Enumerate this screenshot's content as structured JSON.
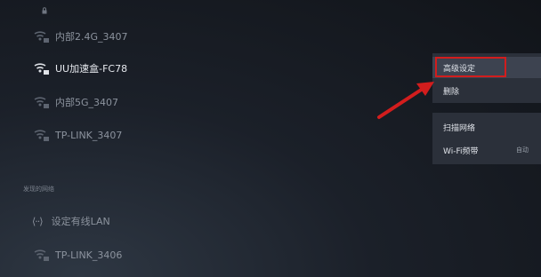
{
  "networks": [
    {
      "name": "内部2.4G_3407",
      "active": false
    },
    {
      "name": "UU加速盒-FC78",
      "active": true
    },
    {
      "name": "内部5G_3407",
      "active": false
    },
    {
      "name": "TP-LINK_3407",
      "active": false
    }
  ],
  "section": {
    "label": "发现的网络"
  },
  "wired": {
    "label": "设定有线LAN"
  },
  "network_bottom": {
    "name": "TP-LINK_3406"
  },
  "context_menu": {
    "advanced_label": "高级设定",
    "delete_label": "删除",
    "scan_label": "扫描网络",
    "band_label": "Wi-Fi频带",
    "band_value": "自动"
  },
  "colors": {
    "accent_red": "#d21d1d",
    "menu_bg": "#2b303a"
  }
}
